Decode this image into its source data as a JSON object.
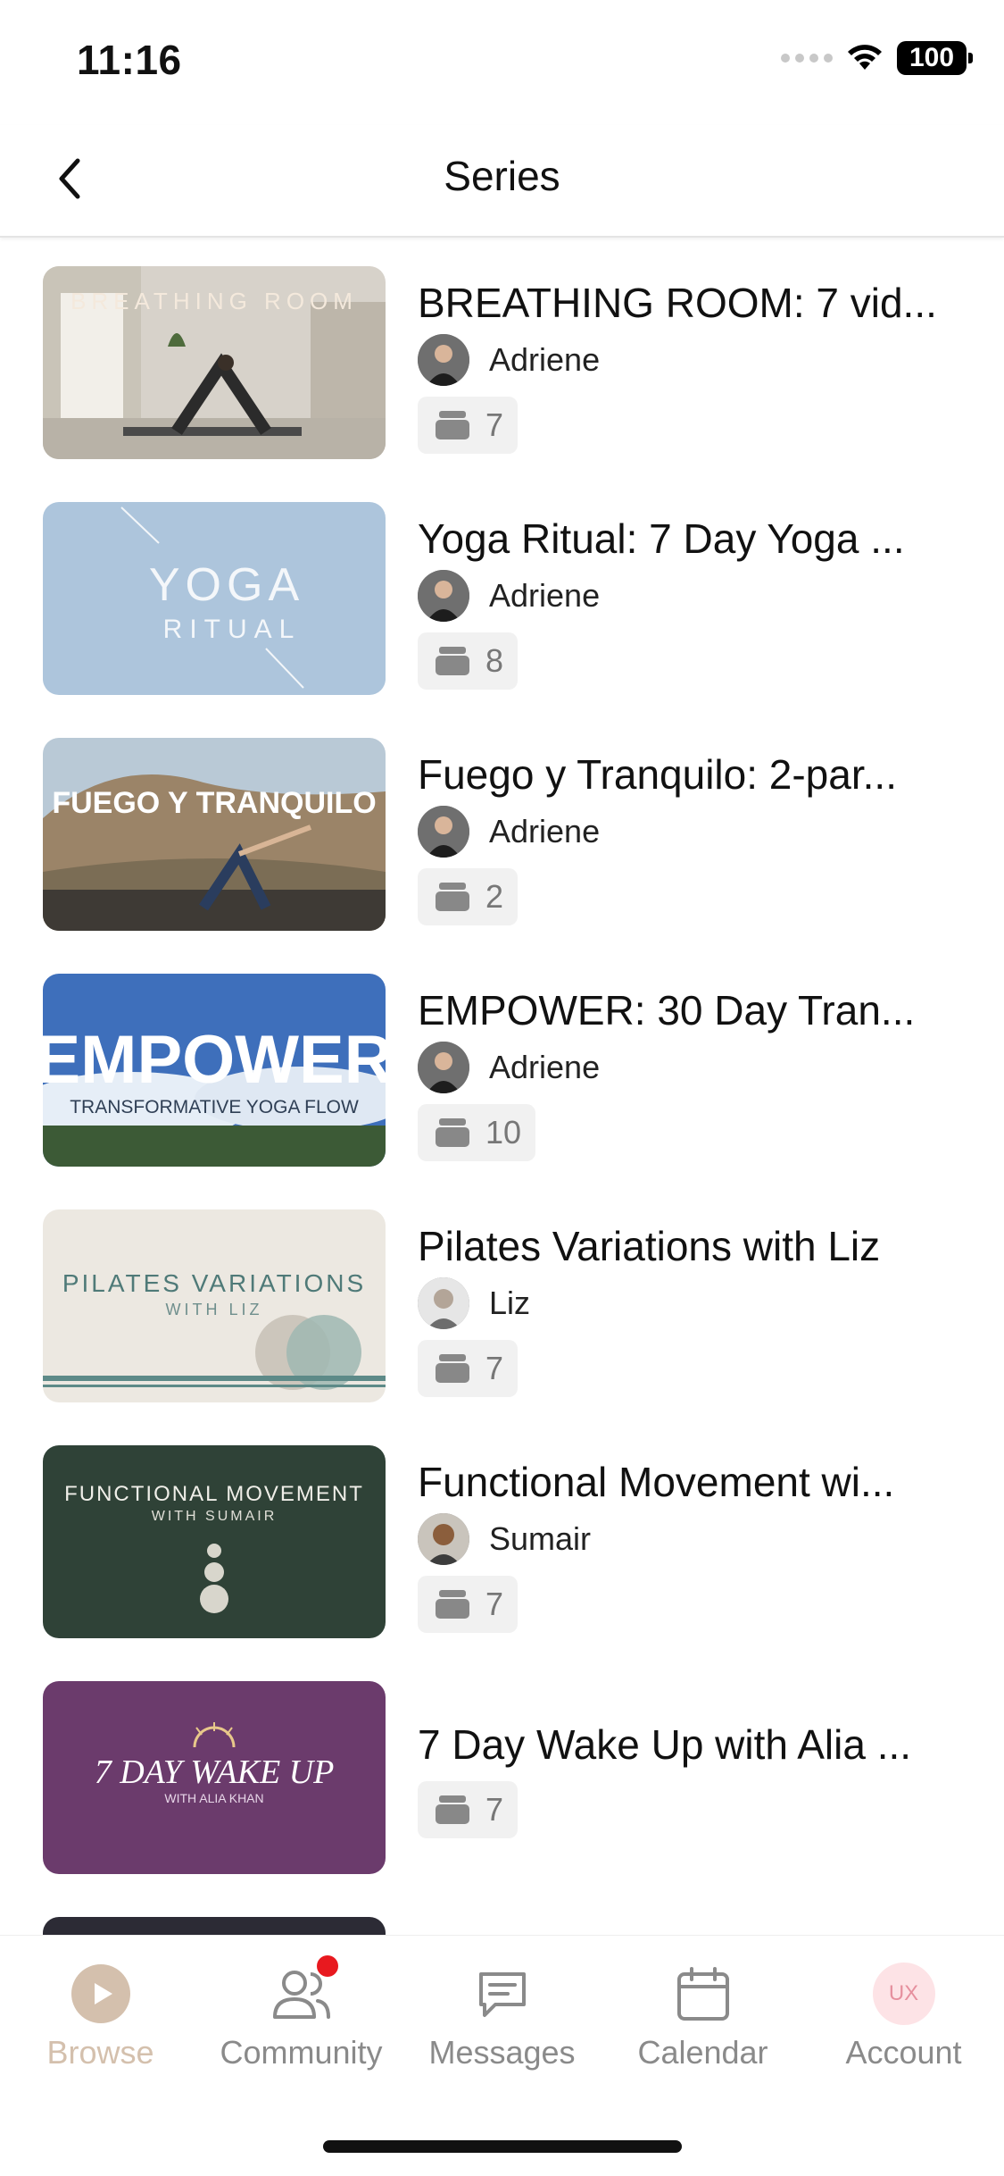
{
  "status_bar": {
    "time": "11:16",
    "battery": "100"
  },
  "header": {
    "title": "Series"
  },
  "series": [
    {
      "title": "BREATHING ROOM: 7 vid...",
      "author": "Adriene",
      "count": "7",
      "thumb_text": "BREATHING ROOM"
    },
    {
      "title": "Yoga Ritual: 7 Day Yoga ...",
      "author": "Adriene",
      "count": "8",
      "thumb_text": "YOGA",
      "thumb_sub": "RITUAL"
    },
    {
      "title": "Fuego y Tranquilo: 2-par...",
      "author": "Adriene",
      "count": "2",
      "thumb_text": "FUEGO Y TRANQUILO"
    },
    {
      "title": "EMPOWER: 30 Day Tran...",
      "author": "Adriene",
      "count": "10",
      "thumb_text": "EMPOWER",
      "thumb_sub": "TRANSFORMATIVE YOGA FLOW"
    },
    {
      "title": "Pilates Variations with Liz",
      "author": "Liz",
      "count": "7",
      "thumb_text": "PILATES VARIATIONS",
      "thumb_sub": "WITH LIZ"
    },
    {
      "title": "Functional Movement wi...",
      "author": "Sumair",
      "count": "7",
      "thumb_text": "FUNCTIONAL MOVEMENT",
      "thumb_sub": "WITH SUMAIR"
    },
    {
      "title": "7 Day Wake Up with Alia ...",
      "author": "",
      "count": "7",
      "thumb_text": "7 DAY WAKE UP",
      "thumb_sub": "WITH ALIA KHAN"
    }
  ],
  "tabs": [
    {
      "label": "Browse",
      "icon": "play-icon",
      "active": true
    },
    {
      "label": "Community",
      "icon": "people-icon",
      "badge": true
    },
    {
      "label": "Messages",
      "icon": "chat-icon"
    },
    {
      "label": "Calendar",
      "icon": "calendar-icon"
    },
    {
      "label": "Account",
      "icon": "account-icon",
      "initials": "UX"
    }
  ],
  "colors": {
    "active_tab": "#d4c0ad",
    "inactive_tab": "#8a8a8a",
    "badge": "#e8191f"
  }
}
